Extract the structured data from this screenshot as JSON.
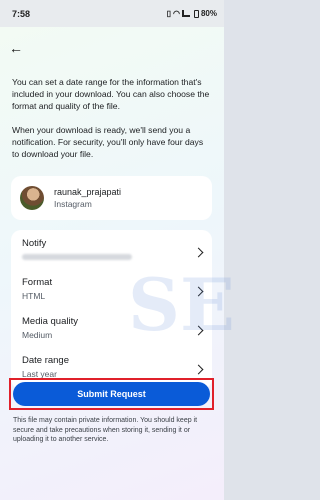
{
  "status_bar": {
    "time": "7:58",
    "icons": [
      "vibrate-icon",
      "wifi-icon",
      "signal-icon",
      "battery-icon"
    ],
    "battery_text": "80%"
  },
  "header": {
    "back_icon": "arrow-left-icon",
    "back_glyph": "←"
  },
  "description": {
    "paragraph1": "You can set a date range for the information that's included in your download. You can also choose the format and quality of the file.",
    "paragraph2": "When your download is ready, we'll send you a notification. For security, you'll only have four days to download your file."
  },
  "account": {
    "username": "raunak_prajapati",
    "platform": "Instagram"
  },
  "settings": {
    "notify_label": "Notify",
    "format_label": "Format",
    "format_value": "HTML",
    "quality_label": "Media quality",
    "quality_value": "Medium",
    "range_label": "Date range",
    "range_value": "Last year"
  },
  "watermark_text": "SE",
  "submit": {
    "label": "Submit Request",
    "color": "#0a5bd8",
    "highlight_color": "#e0202a"
  },
  "footnote": "This file may contain private information. You should keep it secure and take precautions when storing it, sending it or uploading it to another service."
}
